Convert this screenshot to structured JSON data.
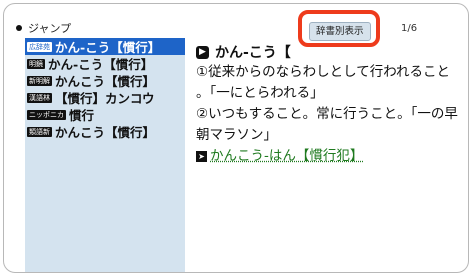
{
  "header": {
    "title": "ジャンプ"
  },
  "sidebar": {
    "items": [
      {
        "dict": "広辞苑",
        "label": "かん-こう【慣行】",
        "selected": true
      },
      {
        "dict": "明鏡",
        "label": "かん-こう【慣行】"
      },
      {
        "dict": "新明解",
        "label": "かんこう【慣行】"
      },
      {
        "dict": "漢語林",
        "label": "【慣行】カンコウ"
      },
      {
        "dict": "ニッポニカ",
        "label": "慣行"
      },
      {
        "dict": "類語新",
        "label": "かんこう【慣行】"
      }
    ]
  },
  "toolbar": {
    "dict_button": "辞書別表示",
    "page": "1/6"
  },
  "entry": {
    "speaker_icon": "speaker-icon",
    "headword": "かん-こう【",
    "definition1": "①従来からのならわしとして行われること",
    "definition1b": "。「一にとらわれる」",
    "definition2": "②いつもすること。常に行うこと。「一の早",
    "definition2b": "朝マラソン」",
    "link_text": "かんこう-はん【慣行犯】"
  },
  "colors": {
    "accent": "#1e64c8",
    "sidebar_bg": "#d4e3ef",
    "highlight": "#ee3b1c",
    "link": "#1f7a1f"
  }
}
